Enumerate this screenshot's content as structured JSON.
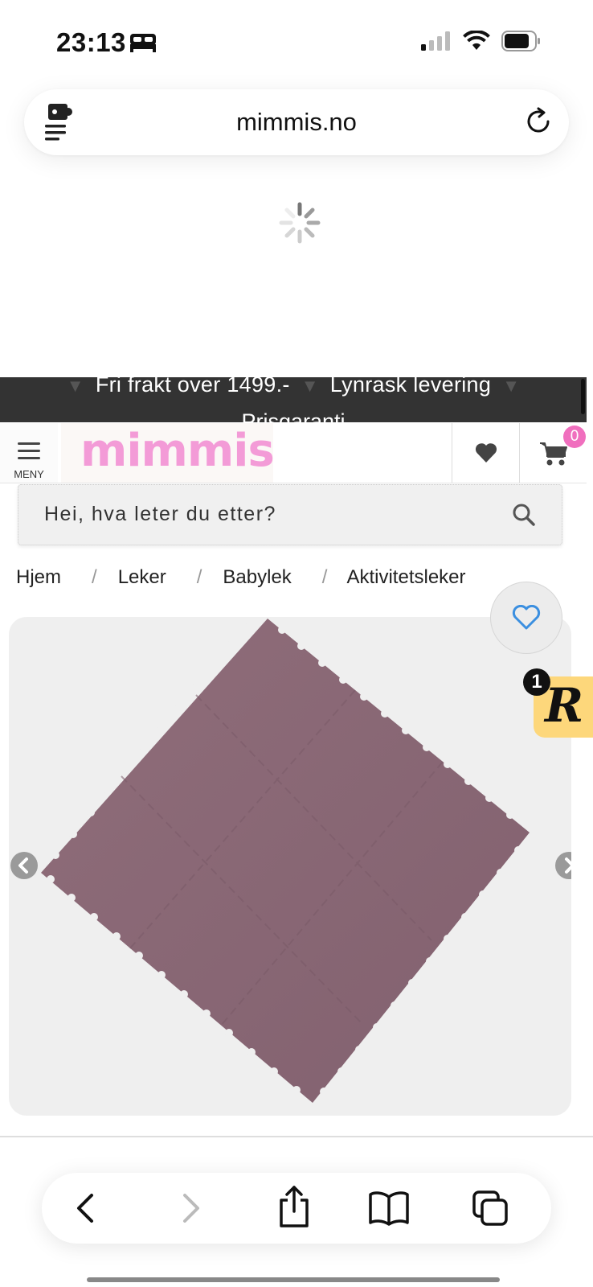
{
  "status_bar": {
    "time": "23:13",
    "icons": [
      "bed-icon",
      "signal-icon",
      "wifi-icon",
      "battery-icon"
    ]
  },
  "browser": {
    "url": "mimmis.no",
    "icons": {
      "extension": "extension-icon",
      "reload": "reload-icon"
    },
    "toolbar": {
      "icons": [
        "back-icon",
        "forward-icon",
        "share-icon",
        "bookmarks-icon",
        "tabs-icon"
      ]
    }
  },
  "promo": {
    "line1_a": "Fri frakt over 1499.-",
    "line1_b": "Lynrask levering",
    "line2": "Prisgaranti"
  },
  "header": {
    "menu_label": "MENY",
    "logo_text": "mimmis",
    "cart_count": "0"
  },
  "search": {
    "placeholder": "Hei, hva leter du etter?"
  },
  "breadcrumb": [
    "Hjem",
    "Leker",
    "Babylek",
    "Aktivitetsleker"
  ],
  "widget": {
    "badge": "1",
    "letter": "R"
  },
  "colors": {
    "brand_pink": "#f39bd7",
    "badge_pink": "#f06fbe",
    "promo_bg": "#333333",
    "mat_color": "#8d6a78",
    "widget_yellow": "#fdd77b",
    "wish_heart": "#3b8fe0"
  }
}
